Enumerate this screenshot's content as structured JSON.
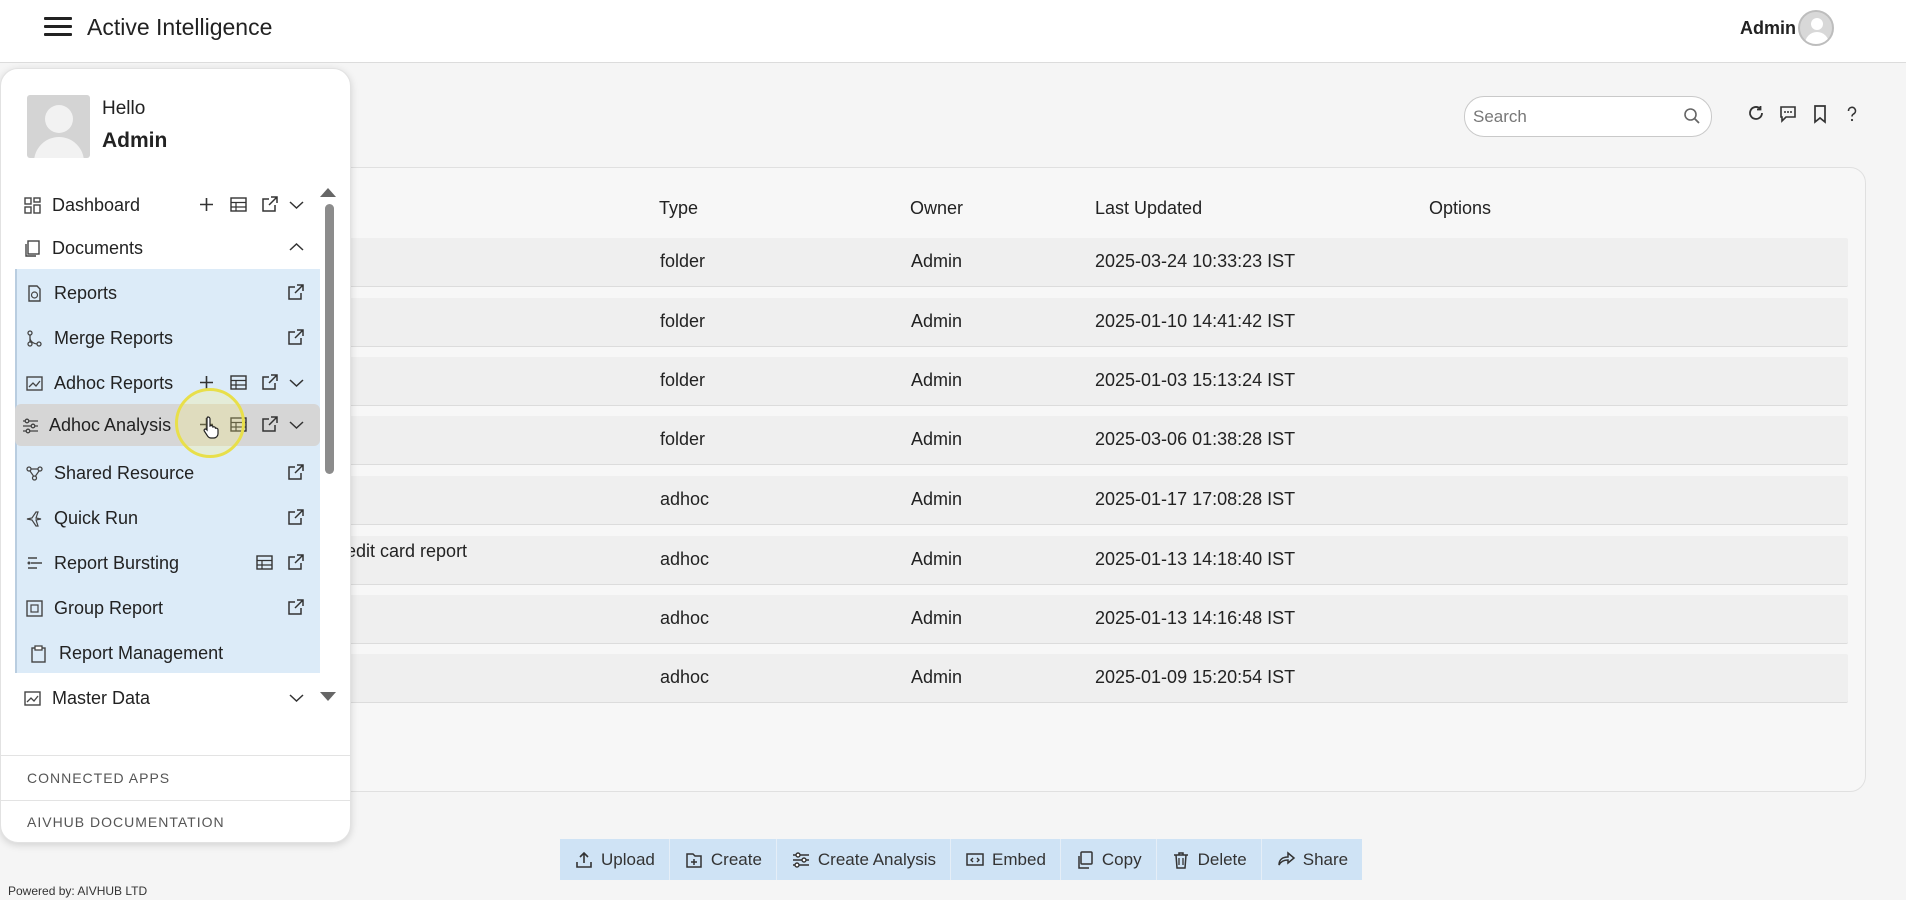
{
  "header": {
    "app_title": "Active Intelligence",
    "user_label": "Admin"
  },
  "search": {
    "placeholder": "Search"
  },
  "toolbar_icons": [
    "refresh-icon",
    "comment-icon",
    "bookmark-icon",
    "help-icon"
  ],
  "table": {
    "columns": [
      "Type",
      "Owner",
      "Last Updated",
      "Options"
    ],
    "rows": [
      {
        "name": "",
        "type": "folder",
        "owner": "Admin",
        "updated": "2025-03-24 10:33:23 IST"
      },
      {
        "name": "",
        "type": "folder",
        "owner": "Admin",
        "updated": "2025-01-10 14:41:42 IST"
      },
      {
        "name": "",
        "type": "folder",
        "owner": "Admin",
        "updated": "2025-01-03 15:13:24 IST"
      },
      {
        "name": "",
        "type": "folder",
        "owner": "Admin",
        "updated": "2025-03-06 01:38:28 IST"
      },
      {
        "name": "",
        "type": "adhoc",
        "owner": "Admin",
        "updated": "2025-01-17 17:08:28 IST"
      },
      {
        "name": "edit card report",
        "type": "adhoc",
        "owner": "Admin",
        "updated": "2025-01-13 14:18:40 IST"
      },
      {
        "name": "",
        "type": "adhoc",
        "owner": "Admin",
        "updated": "2025-01-13 14:16:48 IST"
      },
      {
        "name": "",
        "type": "adhoc",
        "owner": "Admin",
        "updated": "2025-01-09 15:20:54 IST"
      }
    ]
  },
  "actions": [
    "Upload",
    "Create",
    "Create Analysis",
    "Embed",
    "Copy",
    "Delete",
    "Share"
  ],
  "footer": {
    "text": "Powered by: AIVHUB LTD"
  },
  "drawer": {
    "hello": "Hello",
    "name": "Admin",
    "nav": {
      "dashboard": "Dashboard",
      "documents": "Documents",
      "reports": "Reports",
      "merge_reports": "Merge Reports",
      "adhoc_reports": "Adhoc Reports",
      "adhoc_analysis": "Adhoc Analysis",
      "shared_resource": "Shared Resource",
      "quick_run": "Quick Run",
      "report_bursting": "Report Bursting",
      "group_report": "Group Report",
      "report_management": "Report Management",
      "master_data": "Master Data"
    },
    "links": {
      "connected_apps": "CONNECTED APPS",
      "documentation": "AIVHUB DOCUMENTATION"
    }
  },
  "colors": {
    "submenu_bg": "#dcebf8",
    "action_bar_bg": "#cfe3f5",
    "highlight_row": "#d6d6d6"
  }
}
